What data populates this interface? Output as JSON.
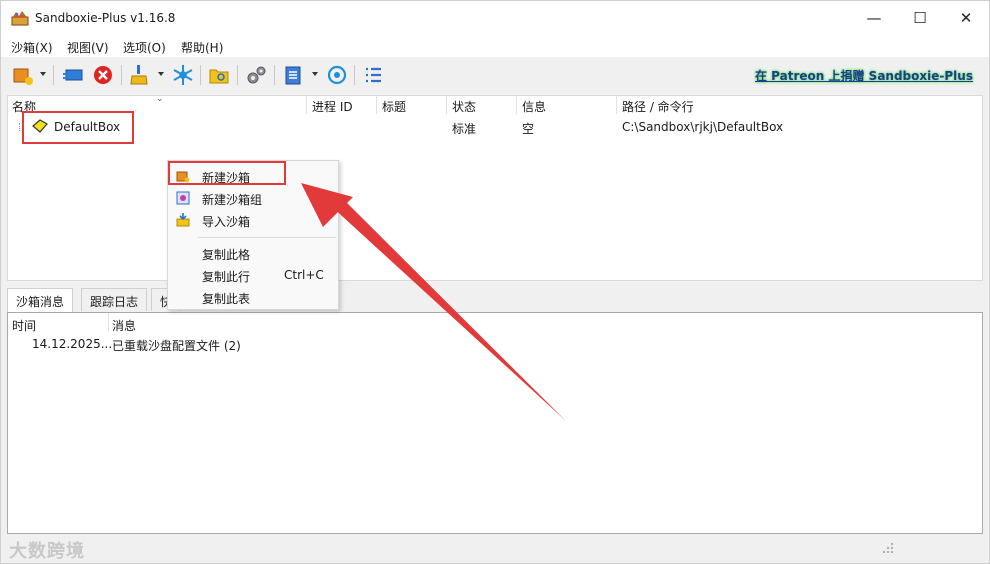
{
  "window": {
    "title": "Sandboxie-Plus v1.16.8",
    "minimize_glyph": "—",
    "maximize_glyph": "☐",
    "close_glyph": "✕"
  },
  "menubar": {
    "items": [
      "沙箱(X)",
      "视图(V)",
      "选项(O)",
      "帮助(H)"
    ]
  },
  "toolbar": {
    "patreon_link": "在 Patreon 上捐赠 Sandboxie-Plus",
    "icons": [
      "new-box-icon",
      "remote-icon",
      "terminate-all-icon",
      "cleanup-icon",
      "freeze-icon",
      "explore-icon",
      "settings-icon",
      "notes-icon",
      "sync-icon",
      "list-icon"
    ]
  },
  "tree": {
    "columns": [
      "名称",
      "进程 ID",
      "标题",
      "状态",
      "信息",
      "路径 / 命令行"
    ],
    "rows": [
      {
        "name": "DefaultBox",
        "pid": "",
        "title": "",
        "status": "标准",
        "info": "空",
        "path": "C:\\Sandbox\\rjkj\\DefaultBox"
      }
    ]
  },
  "context_menu": {
    "items": [
      {
        "label": "新建沙箱",
        "shortcut": "",
        "icon": "new-box-icon"
      },
      {
        "label": "新建沙箱组",
        "shortcut": "",
        "icon": "new-group-icon"
      },
      {
        "label": "导入沙箱",
        "shortcut": "",
        "icon": "import-icon"
      },
      {
        "label": "复制此格",
        "shortcut": ""
      },
      {
        "label": "复制此行",
        "shortcut": "Ctrl+C"
      },
      {
        "label": "复制此表",
        "shortcut": ""
      }
    ]
  },
  "tabs": {
    "items": [
      "沙箱消息",
      "跟踪日志",
      "快"
    ]
  },
  "messages": {
    "columns": [
      "时间",
      "消息"
    ],
    "rows": [
      {
        "time": "14.12.2025...",
        "message": "已重载沙盘配置文件 (2)"
      }
    ]
  },
  "statusbar": {
    "watermark": "大数跨境"
  },
  "colors": {
    "highlight_red": "#e23a3a",
    "patreon_text": "#1c3c8c",
    "patreon_glow": "#6fe06f"
  }
}
